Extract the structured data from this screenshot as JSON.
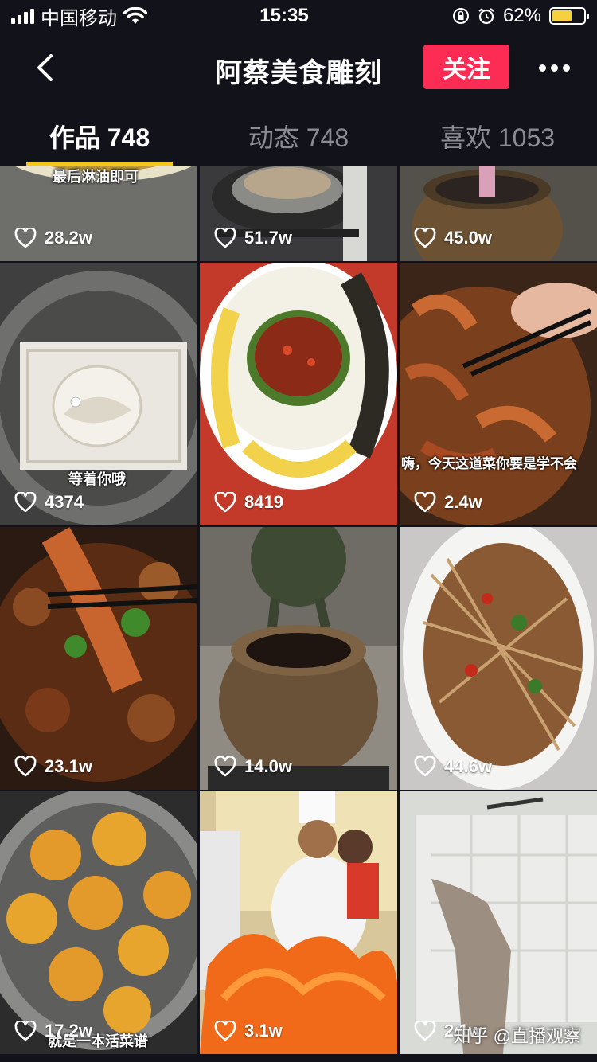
{
  "status_bar": {
    "carrier": "中国移动",
    "time": "15:35",
    "battery": "62%",
    "battery_level": 0.62,
    "icons": [
      "signal-icon",
      "wifi-icon",
      "orientation-lock-icon",
      "alarm-icon",
      "battery-icon"
    ]
  },
  "nav": {
    "title": "阿蔡美食雕刻",
    "follow_label": "关注",
    "follow_color": "#fd2c55"
  },
  "tabs": [
    {
      "label": "作品 748",
      "active": true
    },
    {
      "label": "动态 748",
      "active": false
    },
    {
      "label": "喜欢 1053",
      "active": false
    }
  ],
  "grid": {
    "items": [
      {
        "likes": "28.2w",
        "caption": "最后淋油即可"
      },
      {
        "likes": "51.7w",
        "caption": ""
      },
      {
        "likes": "45.0w",
        "caption": ""
      },
      {
        "likes": "4374",
        "caption": "等着你哦"
      },
      {
        "likes": "8419",
        "caption": ""
      },
      {
        "likes": "2.4w",
        "caption": "嗨，今天这道菜你要是学不会"
      },
      {
        "likes": "23.1w",
        "caption": ""
      },
      {
        "likes": "14.0w",
        "caption": ""
      },
      {
        "likes": "44.6w",
        "caption": ""
      },
      {
        "likes": "17.2w",
        "caption": "就是一本活菜谱"
      },
      {
        "likes": "3.1w",
        "caption": ""
      },
      {
        "likes": "2.1w",
        "caption": ""
      }
    ]
  },
  "watermark": "知乎 @直播观察"
}
